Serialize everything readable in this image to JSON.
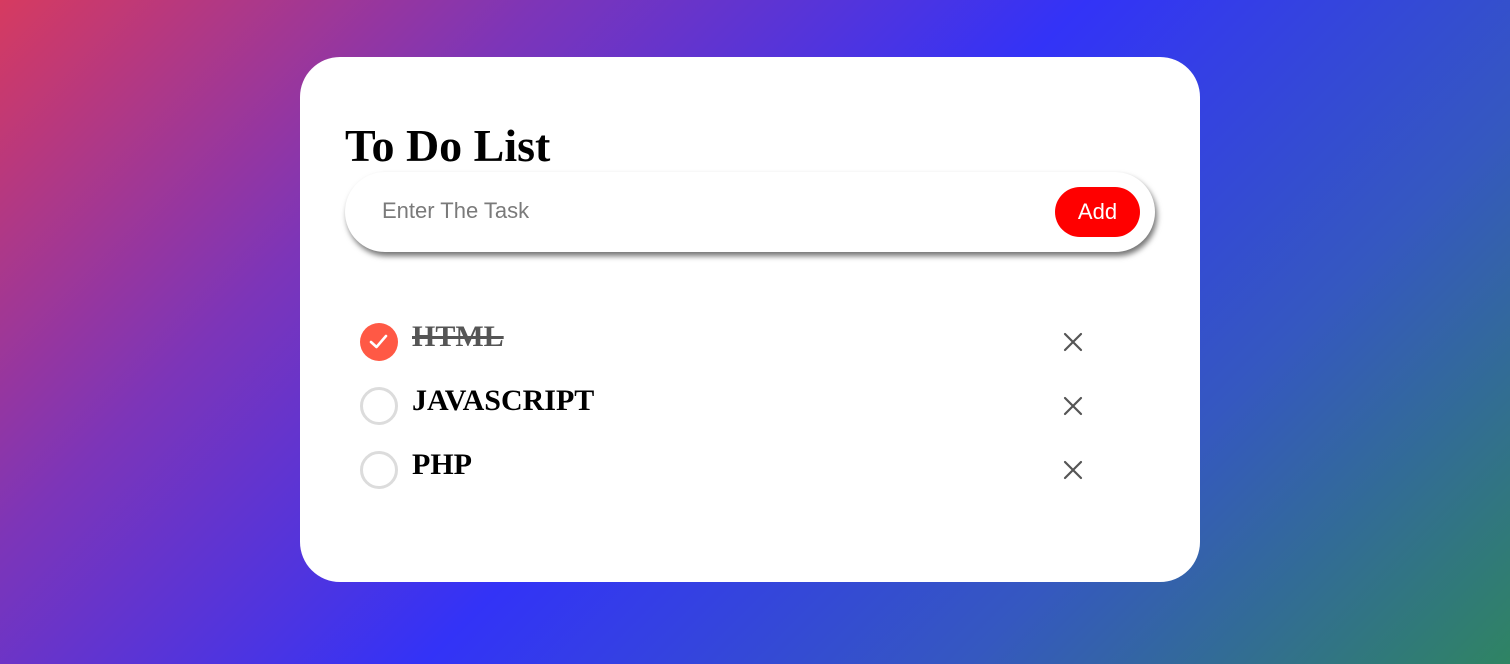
{
  "app": {
    "title": "To Do List"
  },
  "input": {
    "placeholder": "Enter The Task",
    "value": ""
  },
  "add_button": {
    "label": "Add"
  },
  "tasks": [
    {
      "label": "HTML",
      "checked": true,
      "delete_icon": "close-icon"
    },
    {
      "label": "JAVASCRIPT",
      "checked": false,
      "delete_icon": "close-icon"
    },
    {
      "label": "PHP",
      "checked": false,
      "delete_icon": "close-icon"
    }
  ],
  "colors": {
    "accent": "#ff0000",
    "checked": "#ff5945",
    "card": "#ffffff"
  }
}
